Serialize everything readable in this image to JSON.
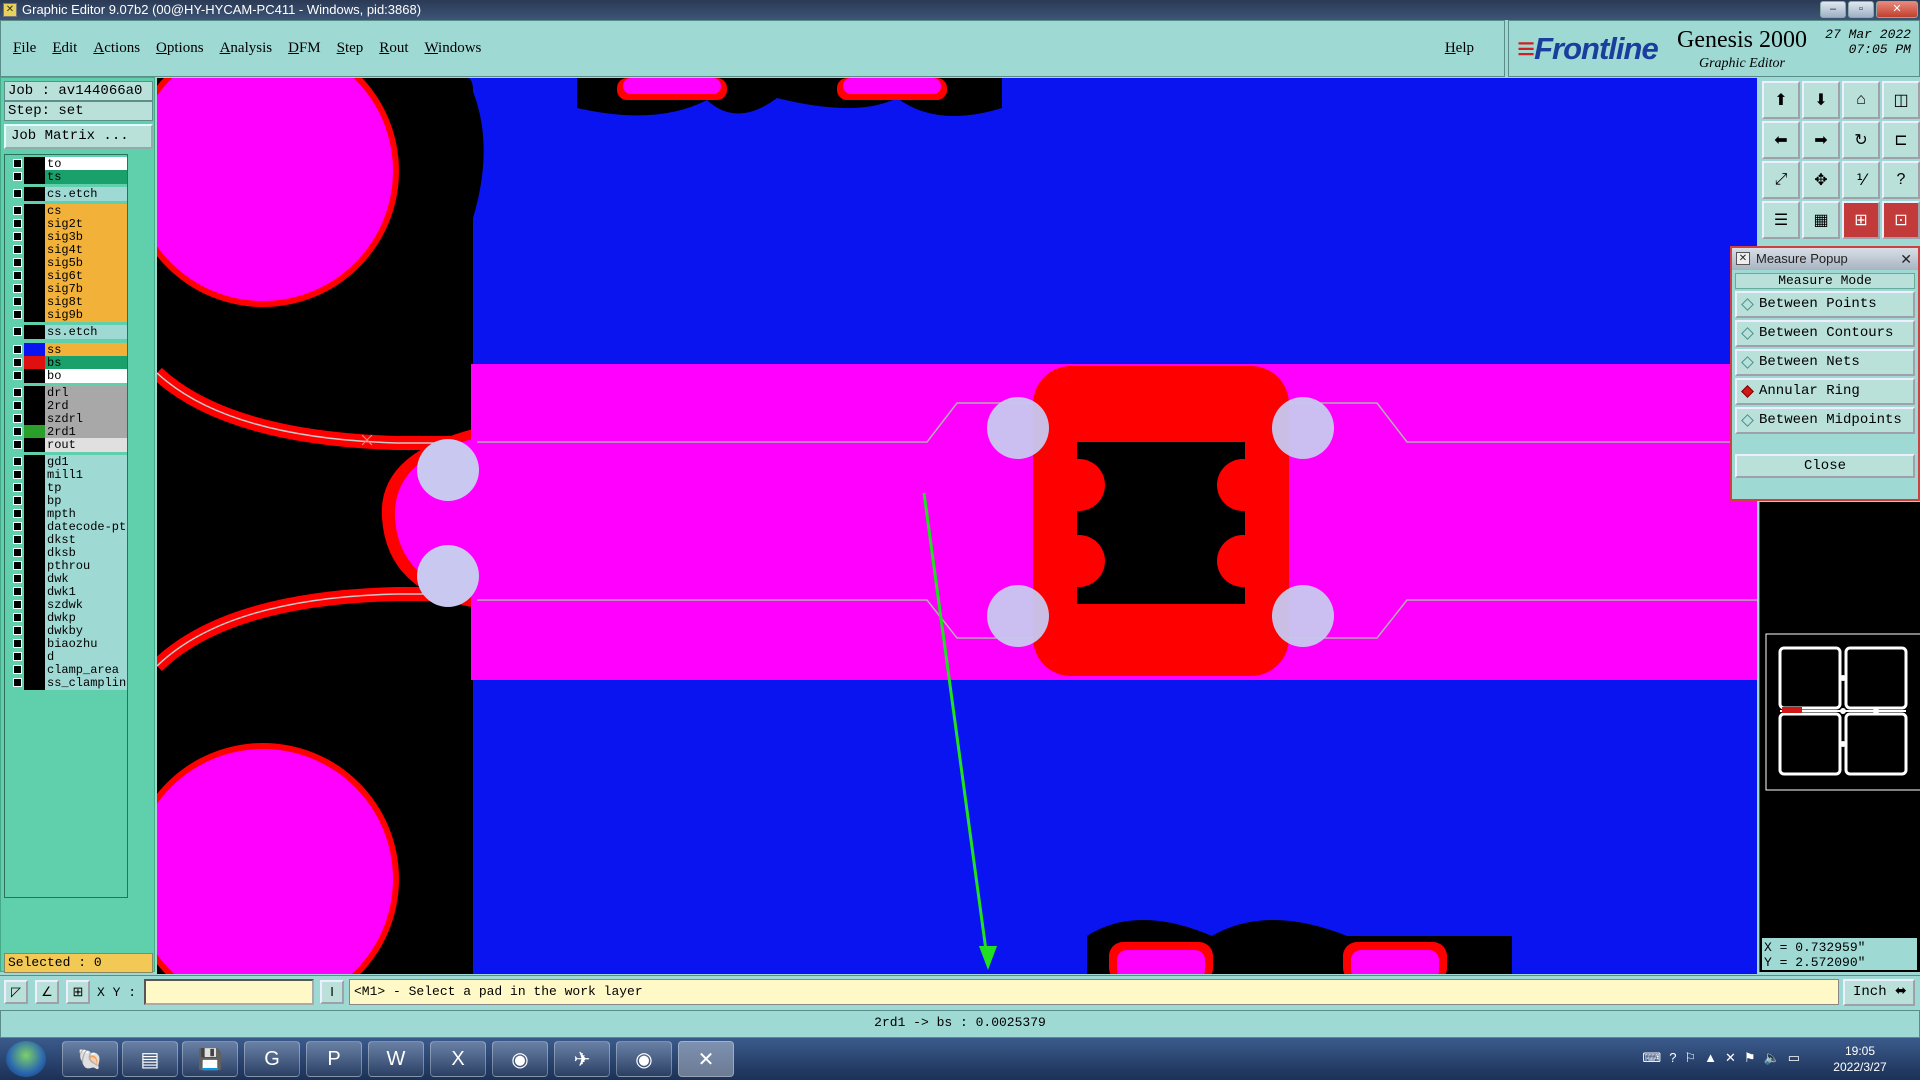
{
  "window": {
    "title": "Graphic Editor 9.07b2 (00@HY-HYCAM-PC411 - Windows, pid:3868)",
    "controls": [
      "–",
      "▫",
      "✕"
    ]
  },
  "menu": {
    "items": [
      "File",
      "Edit",
      "Actions",
      "Options",
      "Analysis",
      "DFM",
      "Step",
      "Rout",
      "Windows"
    ],
    "help": "Help"
  },
  "brand": {
    "logo": "Frontline",
    "product": "Genesis 2000",
    "subtitle": "Graphic Editor",
    "date": "27 Mar 2022",
    "time": "07:05 PM"
  },
  "left": {
    "job": "Job : av144066a0",
    "step": "Step: set",
    "job_matrix": "Job Matrix ...",
    "selected": "Selected : 0"
  },
  "layers": [
    {
      "name": "to",
      "swatch": "#000000",
      "label_bg": "#ffffff"
    },
    {
      "name": "ts",
      "swatch": "#000000",
      "label_bg": "#1aa06a"
    },
    {
      "name": "cs.etch",
      "swatch": "#000000",
      "label_bg": "#9fd9d4"
    },
    {
      "name": "cs",
      "swatch": "#000000",
      "label_bg": "#f2b23a"
    },
    {
      "name": "sig2t",
      "swatch": "#000000",
      "label_bg": "#f2b23a"
    },
    {
      "name": "sig3b",
      "swatch": "#000000",
      "label_bg": "#f2b23a"
    },
    {
      "name": "sig4t",
      "swatch": "#000000",
      "label_bg": "#f2b23a"
    },
    {
      "name": "sig5b",
      "swatch": "#000000",
      "label_bg": "#f2b23a"
    },
    {
      "name": "sig6t",
      "swatch": "#000000",
      "label_bg": "#f2b23a"
    },
    {
      "name": "sig7b",
      "swatch": "#000000",
      "label_bg": "#f2b23a"
    },
    {
      "name": "sig8t",
      "swatch": "#000000",
      "label_bg": "#f2b23a"
    },
    {
      "name": "sig9b",
      "swatch": "#000000",
      "label_bg": "#f2b23a"
    },
    {
      "name": "ss.etch",
      "swatch": "#000000",
      "label_bg": "#9fd9d4"
    },
    {
      "name": "ss",
      "swatch": "#0a14f0",
      "label_bg": "#f2b23a"
    },
    {
      "name": "bs",
      "swatch": "#e01010",
      "label_bg": "#1aa06a"
    },
    {
      "name": "bo",
      "swatch": "#000000",
      "label_bg": "#ffffff"
    },
    {
      "name": "drl",
      "swatch": "#000000",
      "label_bg": "#a8a8a8"
    },
    {
      "name": "2rd",
      "swatch": "#000000",
      "label_bg": "#a8a8a8"
    },
    {
      "name": "szdrl",
      "swatch": "#000000",
      "label_bg": "#a8a8a8"
    },
    {
      "name": "2rd1",
      "swatch": "#2aa02a",
      "label_bg": "#a8a8a8"
    },
    {
      "name": "rout",
      "swatch": "#000000",
      "label_bg": "#e0e0e0"
    },
    {
      "name": "gd1",
      "swatch": "#000000",
      "label_bg": "#9fd9d4"
    },
    {
      "name": "mill1",
      "swatch": "#000000",
      "label_bg": "#9fd9d4"
    },
    {
      "name": "tp",
      "swatch": "#000000",
      "label_bg": "#9fd9d4"
    },
    {
      "name": "bp",
      "swatch": "#000000",
      "label_bg": "#9fd9d4"
    },
    {
      "name": "mpth",
      "swatch": "#000000",
      "label_bg": "#9fd9d4"
    },
    {
      "name": "datecode-pto",
      "swatch": "#000000",
      "label_bg": "#9fd9d4"
    },
    {
      "name": "dkst",
      "swatch": "#000000",
      "label_bg": "#9fd9d4"
    },
    {
      "name": "dksb",
      "swatch": "#000000",
      "label_bg": "#9fd9d4"
    },
    {
      "name": "pthrou",
      "swatch": "#000000",
      "label_bg": "#9fd9d4"
    },
    {
      "name": "dwk",
      "swatch": "#000000",
      "label_bg": "#9fd9d4"
    },
    {
      "name": "dwk1",
      "swatch": "#000000",
      "label_bg": "#9fd9d4"
    },
    {
      "name": "szdwk",
      "swatch": "#000000",
      "label_bg": "#9fd9d4"
    },
    {
      "name": "dwkp",
      "swatch": "#000000",
      "label_bg": "#9fd9d4"
    },
    {
      "name": "dwkby",
      "swatch": "#000000",
      "label_bg": "#9fd9d4"
    },
    {
      "name": "biaozhu",
      "swatch": "#000000",
      "label_bg": "#9fd9d4"
    },
    {
      "name": "d",
      "swatch": "#000000",
      "label_bg": "#9fd9d4"
    },
    {
      "name": "clamp_area",
      "swatch": "#000000",
      "label_bg": "#9fd9d4"
    },
    {
      "name": "ss_clampline",
      "swatch": "#000000",
      "label_bg": "#9fd9d4"
    }
  ],
  "measure": {
    "title": "Measure Popup",
    "mode_label": "Measure Mode",
    "options": [
      "Between Points",
      "Between Contours",
      "Between Nets",
      "Annular Ring",
      "Between Midpoints"
    ],
    "active_option": "Annular Ring",
    "close": "Close"
  },
  "coords": {
    "x": "X = 0.732959\"",
    "y": "Y = 2.572090\""
  },
  "cmd": {
    "xy_label": "X Y :",
    "xy_value": "",
    "prompt": "<M1> - Select a pad in the work layer",
    "unit": "Inch"
  },
  "status": {
    "text": "2rd1 -> bs : 0.0025379"
  },
  "clock": {
    "time": "19:05",
    "date": "2022/3/27"
  },
  "colors": {
    "canvas_bg": "#0a14f0",
    "copper": "#ff00ff",
    "pad_ring": "#ff0000",
    "drill": "#c8c8f0"
  }
}
